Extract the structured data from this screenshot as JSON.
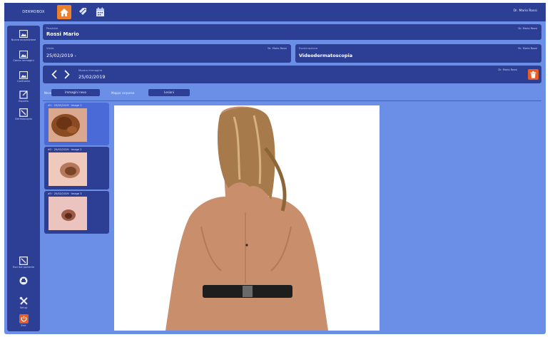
{
  "topbar": {
    "brand": "DERMOBOX",
    "user_label": "Dr. Mario Rossi",
    "icons": [
      "home-icon",
      "tag-icon",
      "calendar-icon"
    ]
  },
  "sidebar": {
    "items": [
      {
        "label": "Nuova acquisizione",
        "icon": "image-add-icon"
      },
      {
        "label": "Carica immagini",
        "icon": "image-upload-icon"
      },
      {
        "label": "Confronta",
        "icon": "image-compare-icon"
      },
      {
        "label": "Esporta",
        "icon": "export-icon"
      },
      {
        "label": "Dermoscopio",
        "icon": "crop-icon"
      }
    ],
    "bottom": [
      {
        "label": "Esci dal paziente",
        "icon": "exit-icon"
      },
      {
        "label": "",
        "icon": "print-icon"
      },
      {
        "label": "Setup",
        "icon": "tools-icon"
      },
      {
        "label": "Esci",
        "icon": "power-icon"
      }
    ]
  },
  "patient": {
    "caption": "Paziente",
    "name": "Rossi Mario",
    "right": "Dr. Mario Rossi"
  },
  "visit": {
    "caption": "Visita",
    "date": "25/02/2019 -",
    "right": "Dr. Mario Rossi"
  },
  "exam": {
    "caption": "Esaminazione",
    "value": "Videodermatoscopia",
    "right": "Dr. Mario Rossi"
  },
  "image_nav": {
    "caption": "Mostra immagine",
    "date": "25/02/2019",
    "right": "Dr. Mario Rossi"
  },
  "tabs": {
    "zoom_label": "Nevo",
    "btn1": "Immagini nevo",
    "mid_label": "Mappa corporea",
    "btn2": "Lesioni"
  },
  "thumbnails": [
    {
      "caption": "#1 · 25/02/2019 · Image 1",
      "selected": true
    },
    {
      "caption": "#2 · 25/02/2019 · Image 2",
      "selected": false
    },
    {
      "caption": "#3 · 25/02/2019 · Image 3",
      "selected": false
    }
  ],
  "colors": {
    "frame": "#6b8fe6",
    "bar": "#2d3f94",
    "accent": "#f07f2a",
    "delete": "#e85d27"
  }
}
